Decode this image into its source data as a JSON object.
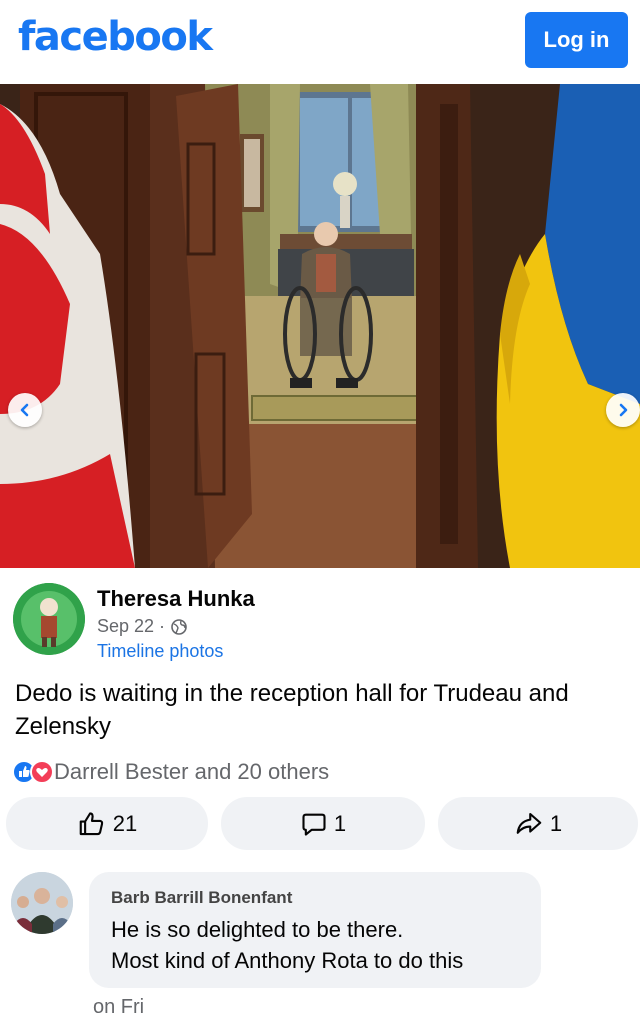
{
  "header": {
    "logo": "facebook",
    "login_label": "Log in"
  },
  "photo": {
    "prev_icon": "chevron-left-icon",
    "next_icon": "chevron-right-icon"
  },
  "post": {
    "author": "Theresa Hunka",
    "date": "Sep 22 ·",
    "audience_icon": "globe-icon",
    "album": "Timeline photos",
    "text": "Dedo is waiting in the reception hall for Trudeau and Zelensky",
    "reactions_summary": "Darrell Bester and 20 others",
    "reaction_icons": [
      "like-reaction-icon",
      "love-reaction-icon"
    ],
    "actions": {
      "like_count": "21",
      "comment_count": "1",
      "share_count": "1"
    }
  },
  "comment": {
    "author": "Barb Barrill Bonenfant",
    "line1": "He is so delighted to be there.",
    "line2": "Most kind of Anthony Rota to do this",
    "time": "on Fri"
  },
  "colors": {
    "brand": "#1877f2",
    "link": "#1b74e4",
    "secondary_text": "#65676b",
    "button_bg": "#f0f2f5"
  }
}
